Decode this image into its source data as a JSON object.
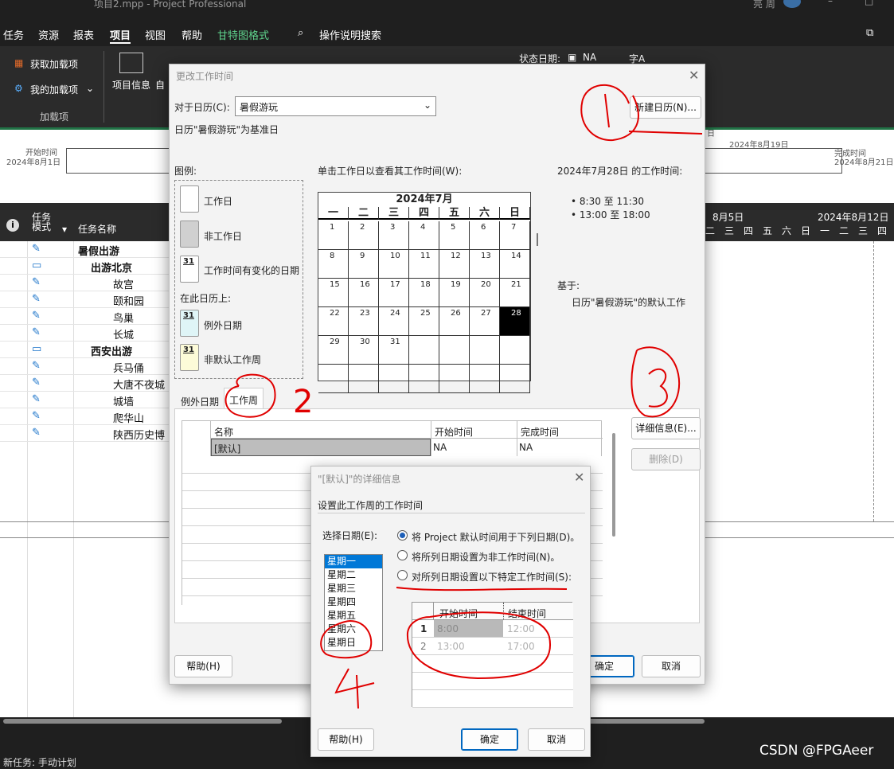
{
  "titlebar": {
    "file": "项目2.mpp - Project Professional",
    "user": "亮 周"
  },
  "menubar": {
    "items": [
      "任务",
      "资源",
      "报表",
      "项目",
      "视图",
      "帮助",
      "甘特图格式"
    ],
    "search": "操作说明搜索"
  },
  "ribbon": {
    "get_addins": "获取加载项",
    "my_addins": "我的加载项",
    "group_addins": "加载项",
    "project_info": "项目信息",
    "auto": "自",
    "status_date_label": "状态日期:",
    "status_date_value": "NA",
    "font": "字A"
  },
  "timeline": {
    "start_label": "开始时间",
    "start_date": "2024年8月1日",
    "end_label": "完成时间",
    "end_date": "2024年8月21日",
    "tick1": "2024年8月19日",
    "date_mark": "日"
  },
  "gridheader": {
    "info_icon": "i",
    "mode": "任务模式",
    "name": "任务名称",
    "week1": "8月5日",
    "week2": "2024年8月12日",
    "days": [
      "二",
      "三",
      "四",
      "五",
      "六",
      "日",
      "一",
      "二",
      "三",
      "四"
    ]
  },
  "tasks": [
    {
      "name": "暑假出游",
      "level": 0,
      "summary": true
    },
    {
      "name": "出游北京",
      "level": 1,
      "summary": true
    },
    {
      "name": "故宫",
      "level": 2
    },
    {
      "name": "颐和园",
      "level": 2
    },
    {
      "name": "鸟巢",
      "level": 2
    },
    {
      "name": "长城",
      "level": 2
    },
    {
      "name": "西安出游",
      "level": 1,
      "summary": true
    },
    {
      "name": "兵马俑",
      "level": 2
    },
    {
      "name": "大唐不夜城",
      "level": 2
    },
    {
      "name": "城墙",
      "level": 2
    },
    {
      "name": "爬华山",
      "level": 2
    },
    {
      "name": "陕西历史博",
      "level": 2
    }
  ],
  "statusbar": {
    "new_task": "新任务: 手动计划",
    "watermark": "CSDN @FPGAeer"
  },
  "dialog": {
    "title": "更改工作时间",
    "for_calendar_label": "对于日历(C):",
    "calendar_value": "暑假游玩",
    "base_text": "日历\"暑假游玩\"为基准日",
    "new_calendar": "新建日历(N)...",
    "legend_title": "图例:",
    "legend": {
      "workday": "工作日",
      "nonwork": "非工作日",
      "changed": "工作时间有变化的日期",
      "on_this": "在此日历上:",
      "exception": "例外日期",
      "nondefault": "非默认工作周",
      "num": "31"
    },
    "click_hint": "单击工作日以查看其工作时间(W):",
    "month": "2024年7月",
    "weekdays": [
      "一",
      "二",
      "三",
      "四",
      "五",
      "六",
      "日"
    ],
    "days": [
      "1",
      "2",
      "3",
      "4",
      "5",
      "6",
      "7",
      "8",
      "9",
      "10",
      "11",
      "12",
      "13",
      "14",
      "15",
      "16",
      "17",
      "18",
      "19",
      "20",
      "21",
      "22",
      "23",
      "24",
      "25",
      "26",
      "27",
      "28",
      "29",
      "30",
      "31"
    ],
    "selected_day": "28",
    "worktime_title": "2024年7月28日 的工作时间:",
    "worktimes": [
      "• 8:30 至 11:30",
      "• 13:00 至 18:00"
    ],
    "based_on": "基于:",
    "based_on_text": "日历\"暑假游玩\"的默认工作",
    "tab_exception": "例外日期",
    "tab_workweek": "工作周",
    "col_name": "名称",
    "col_start": "开始时间",
    "col_end": "完成时间",
    "row_name": "[默认]",
    "row_start": "NA",
    "row_end": "NA",
    "details": "详细信息(E)...",
    "delete": "删除(D)",
    "help": "帮助(H)",
    "ok": "确定",
    "cancel": "取消"
  },
  "detail": {
    "title": "\"[默认]\"的详细信息",
    "subtitle": "设置此工作周的工作时间",
    "select_day": "选择日期(E):",
    "days": [
      "星期一",
      "星期二",
      "星期三",
      "星期四",
      "星期五",
      "星期六",
      "星期日"
    ],
    "opt1": "将 Project 默认时间用于下列日期(D)。",
    "opt2": "将所列日期设置为非工作时间(N)。",
    "opt3": "对所列日期设置以下特定工作时间(S):",
    "col_start": "开始时间",
    "col_end": "结束时间",
    "rows": [
      {
        "n": "1",
        "s": "8:00",
        "e": "12:00"
      },
      {
        "n": "2",
        "s": "13:00",
        "e": "17:00"
      }
    ],
    "help": "帮助(H)",
    "ok": "确定",
    "cancel": "取消"
  },
  "annotations": {
    "n2": "2",
    "n4": "4"
  },
  "colors": {
    "accent": "#0067c0",
    "ink": "#e00000",
    "green": "#217346"
  }
}
